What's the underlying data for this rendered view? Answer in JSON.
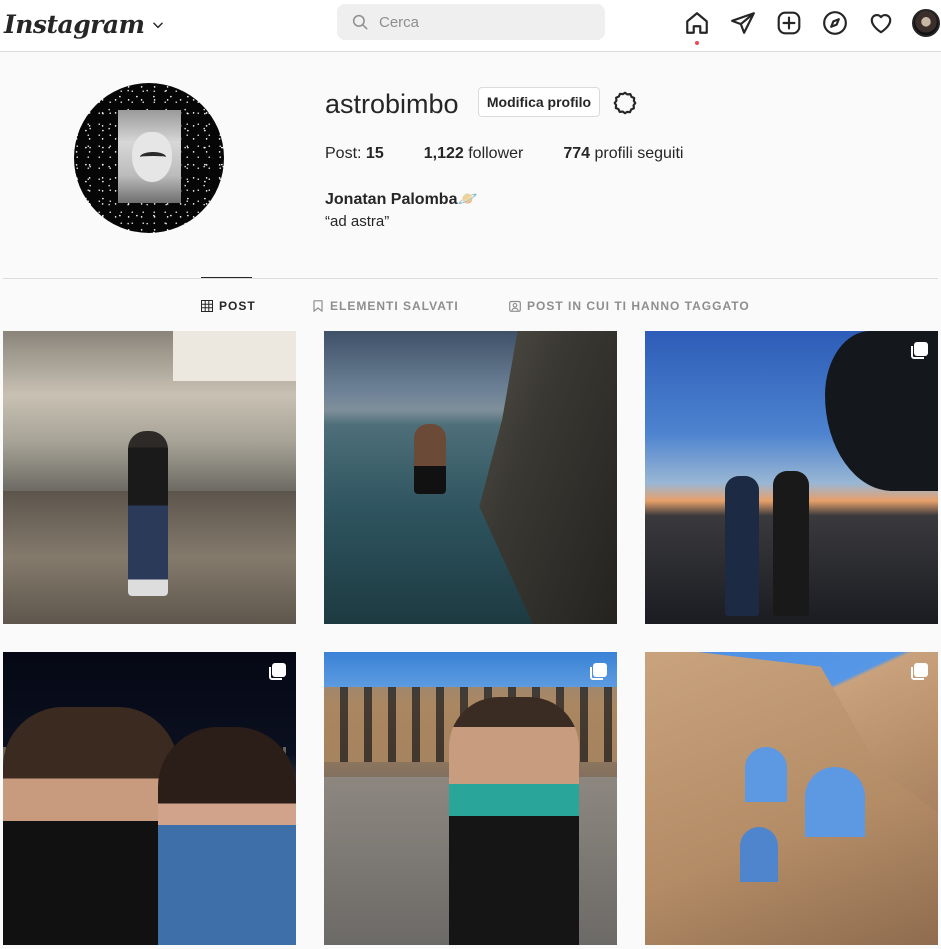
{
  "nav": {
    "logo_text": "Instagram",
    "search_placeholder": "Cerca",
    "icons": [
      "home-icon",
      "direct-icon",
      "new-post-icon",
      "explore-icon",
      "activity-icon",
      "profile-avatar"
    ]
  },
  "profile": {
    "username": "astrobimbo",
    "edit_label": "Modifica profilo",
    "posts_label": "Post:",
    "posts_count": "15",
    "followers_count": "1,122",
    "followers_label": "follower",
    "following_count": "774",
    "following_label": "profili seguiti",
    "full_name": "Jonatan Palomba🪐",
    "bio": "“ad astra”"
  },
  "tabs": [
    {
      "label": "POST",
      "active": true,
      "icon": "grid-icon"
    },
    {
      "label": "ELEMENTI SALVATI",
      "active": false,
      "icon": "bookmark-icon"
    },
    {
      "label": "POST IN CUI TI HANNO TAGGATO",
      "active": false,
      "icon": "tag-icon"
    }
  ],
  "posts": [
    {
      "carousel": false
    },
    {
      "carousel": false
    },
    {
      "carousel": true
    },
    {
      "carousel": true
    },
    {
      "carousel": true
    },
    {
      "carousel": true
    }
  ],
  "colors": {
    "accent_dot": "#ed4956",
    "border": "#dbdbdb",
    "text": "#262626",
    "muted": "#8e8e8e"
  }
}
